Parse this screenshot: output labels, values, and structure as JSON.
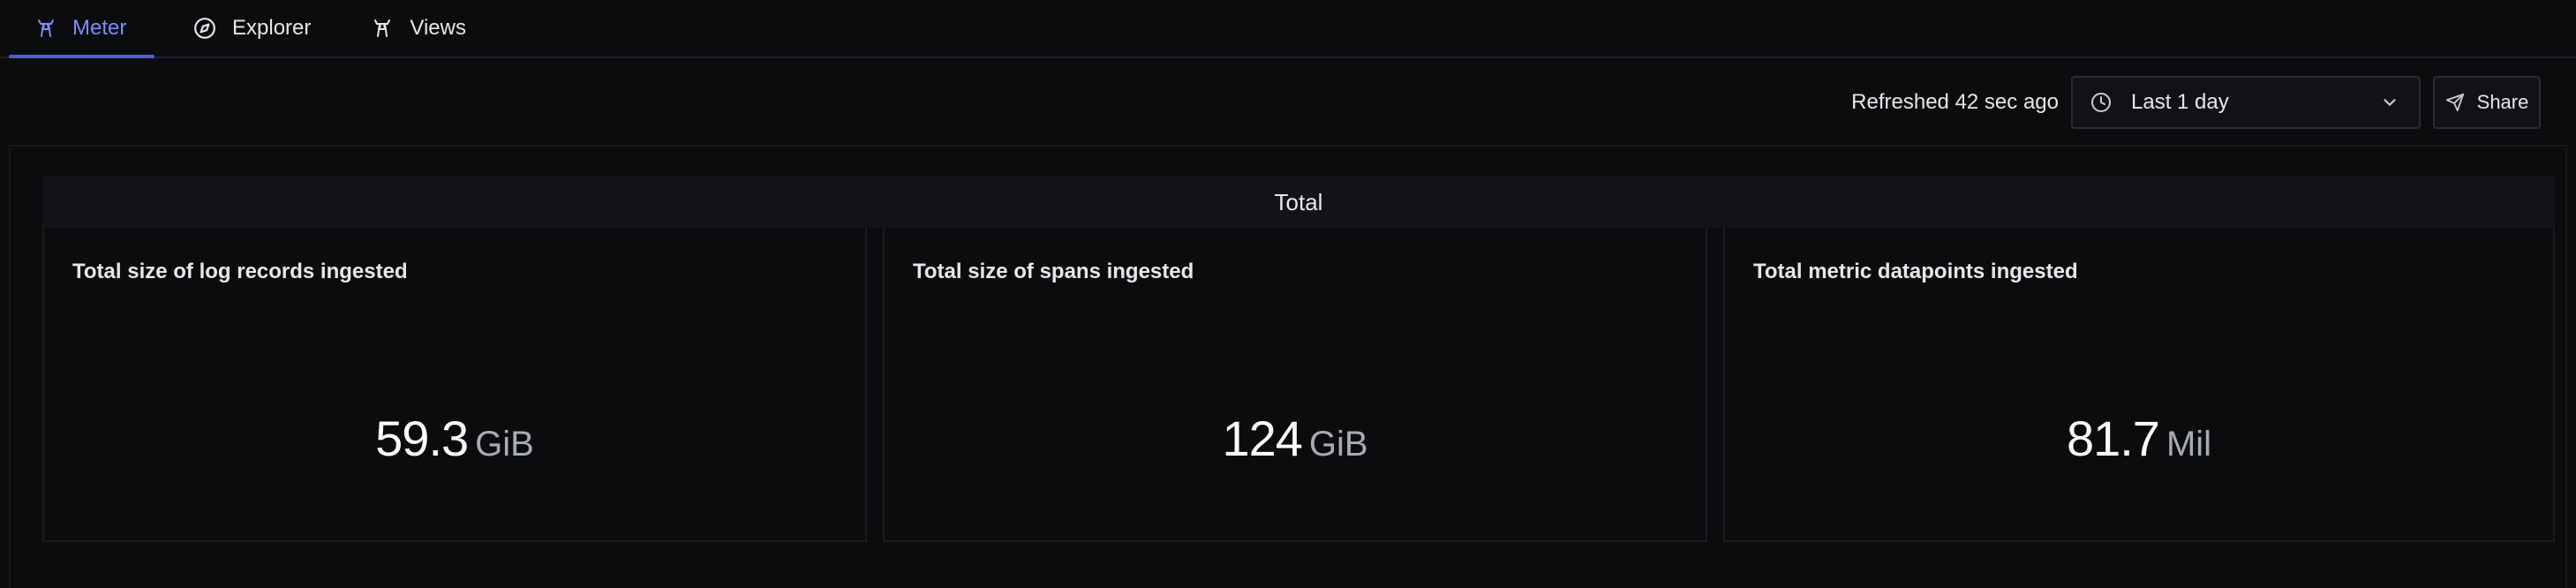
{
  "tabs": [
    {
      "label": "Meter",
      "icon": "tower-icon",
      "active": true
    },
    {
      "label": "Explorer",
      "icon": "compass-icon",
      "active": false
    },
    {
      "label": "Views",
      "icon": "tower-icon",
      "active": false
    }
  ],
  "toolbar": {
    "refreshed_text": "Refreshed 42 sec ago",
    "time_range": "Last 1 day",
    "share_label": "Share"
  },
  "section": {
    "title": "Total"
  },
  "panels": [
    {
      "title": "Total size of log records ingested",
      "value": "59.3",
      "unit": "GiB"
    },
    {
      "title": "Total size of spans ingested",
      "value": "124",
      "unit": "GiB"
    },
    {
      "title": "Total metric datapoints ingested",
      "value": "81.7",
      "unit": "Mil"
    }
  ],
  "colors": {
    "accent": "#7b8cff",
    "background": "#0b0c0e",
    "panel_header": "#131418"
  }
}
